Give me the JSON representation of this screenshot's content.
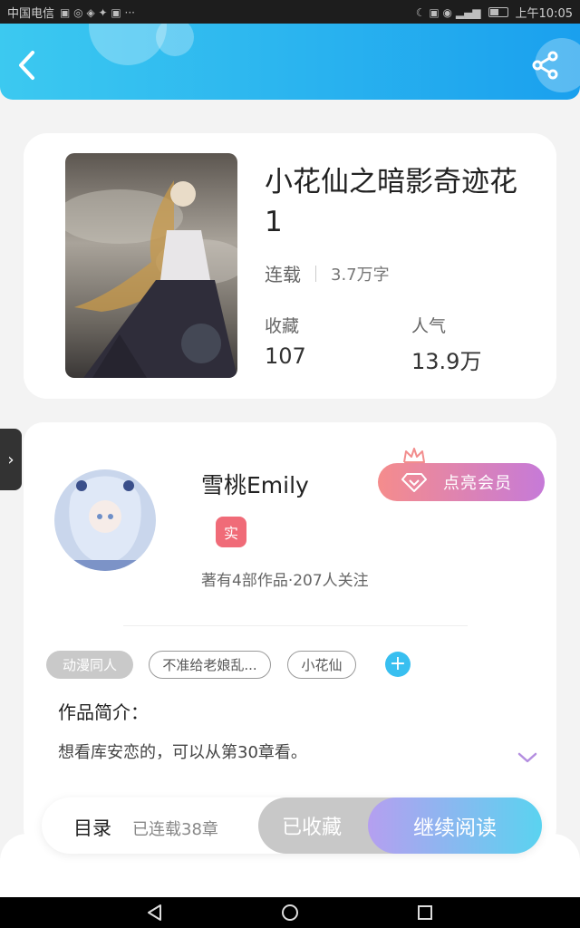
{
  "statusbar": {
    "carrier": "中国电信",
    "left_glyphs": "▣ ◎ ◈ ✦ ▣ ···",
    "right_glyphs": "☾ ▣ ◉ ▂▄▆",
    "time": "上午10:05"
  },
  "header": {
    "back_icon": "chevron-left-icon",
    "share_icon": "share-icon",
    "accent_color": "#2ab4f0"
  },
  "book": {
    "title": "小花仙之暗影奇迹花1",
    "status": "连载",
    "word_count": "3.7万字",
    "favorites_label": "收藏",
    "favorites_value": "107",
    "popularity_label": "人气",
    "popularity_value": "13.9万"
  },
  "side_tab": {
    "glyph": "›"
  },
  "author": {
    "name": "雪桃Emily",
    "verified_badge": "实",
    "meta": "著有4部作品·207人关注",
    "vip_button": "点亮会员"
  },
  "tags": [
    {
      "label": "动漫同人",
      "style": "filled"
    },
    {
      "label": "不准给老娘乱...",
      "style": "outline"
    },
    {
      "label": "小花仙",
      "style": "outline"
    }
  ],
  "tag_add": "+",
  "intro": {
    "title": "作品简介：",
    "text": "想看库安恋的，可以从第30章看。"
  },
  "action_bar": {
    "toc_label": "目录",
    "toc_count": "已连载38章",
    "collected_label": "已收藏",
    "read_label": "继续阅读"
  },
  "navbar": {
    "back_icon": "triangle-back-icon",
    "home_icon": "circle-home-icon",
    "recents_icon": "square-recents-icon"
  }
}
